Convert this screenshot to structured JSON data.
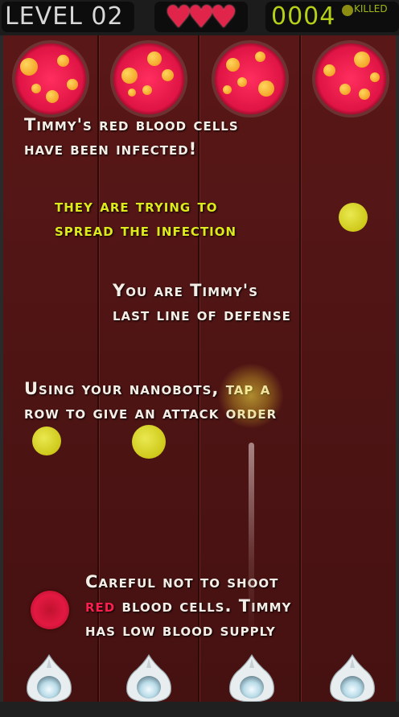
{
  "hud": {
    "level_text": "LEVEL 02",
    "lives": 3,
    "heart_glyph": "♥",
    "score": "0004",
    "killed_label": "KILLED"
  },
  "messages": {
    "intro_line1": "Timmy's red blood cells",
    "intro_line2": "have been infected!",
    "spread_line1": "they are trying to",
    "spread_line2": "spread the infection",
    "defense_line1": "You are Timmy's",
    "defense_line2": "last line of defense",
    "attack_line1": "Using your nanobots, tap a",
    "attack_line2": "row to give an attack order",
    "careful_line1": "Careful not to shoot",
    "careful_red_word": "red",
    "careful_line2_rest": " blood cells. Timmy",
    "careful_line3": "has low blood supply"
  },
  "colors": {
    "background": "#4e1414",
    "heart": "#e0244a",
    "score": "#b6cf17",
    "yellow_text": "#ddea1c",
    "red_word": "#ff1f4f"
  },
  "icons": {
    "lives": "heart-icon",
    "killed": "virus-icon",
    "launcher": "nanobot-icon"
  }
}
